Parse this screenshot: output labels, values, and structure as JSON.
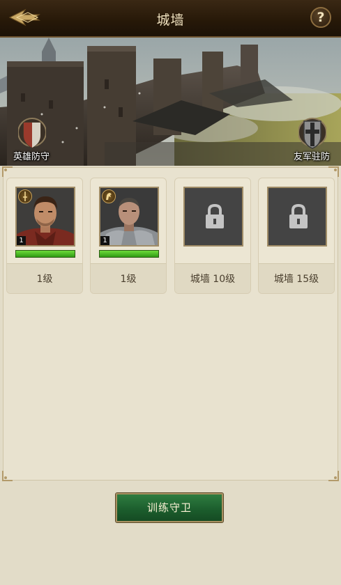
{
  "header": {
    "title": "城墙",
    "help_label": "?"
  },
  "banner": {
    "hero_defense_label": "英雄防守",
    "ally_garrison_label": "友军驻防"
  },
  "slots": [
    {
      "type": "hero",
      "level_badge": "1",
      "label": "1级",
      "bar_fill": 1.0
    },
    {
      "type": "hero",
      "level_badge": "1",
      "label": "1级",
      "bar_fill": 1.0
    },
    {
      "type": "locked",
      "label": "城墙 10级"
    },
    {
      "type": "locked",
      "label": "城墙 15级"
    }
  ],
  "train_button": {
    "label": "训练守卫"
  },
  "colors": {
    "accent_green": "#1b5c2c",
    "bar_green": "#4fbf28",
    "header_brown": "#261808"
  }
}
